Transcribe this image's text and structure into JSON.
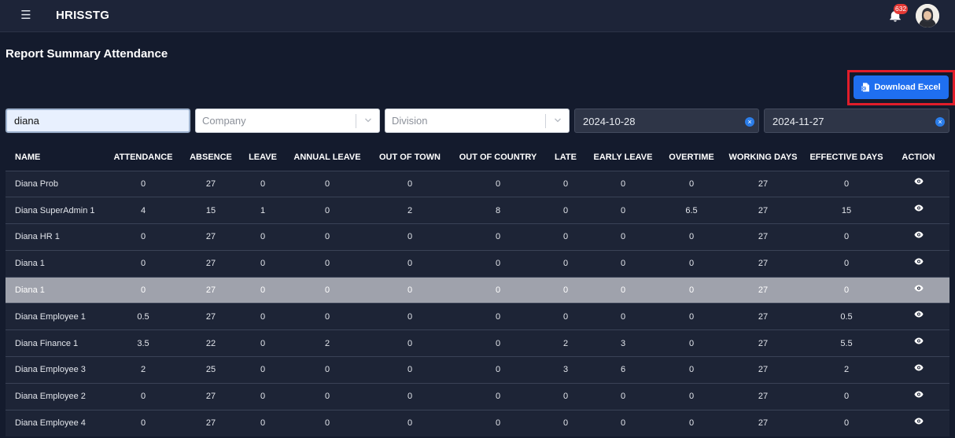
{
  "header": {
    "menu_icon": "hamburger-icon",
    "app_title": "HRISSTG",
    "notification_count": "632",
    "bell_icon": "bell-icon",
    "avatar_icon": "user-avatar"
  },
  "page": {
    "title": "Report Summary Attendance"
  },
  "toolbar": {
    "download_label": "Download Excel",
    "download_icon": "excel-file-icon",
    "highlight_color": "#e11d2a",
    "button_color": "#1f6ff0"
  },
  "filters": {
    "search_value": "diana",
    "company_placeholder": "Company",
    "division_placeholder": "Division",
    "start_date": "2024-10-28",
    "end_date": "2024-11-27"
  },
  "table": {
    "columns": [
      "NAME",
      "ATTENDANCE",
      "ABSENCE",
      "LEAVE",
      "ANNUAL LEAVE",
      "OUT OF TOWN",
      "OUT OF COUNTRY",
      "LATE",
      "EARLY LEAVE",
      "OVERTIME",
      "WORKING DAYS",
      "EFFECTIVE DAYS",
      "ACTION"
    ],
    "rows": [
      {
        "name": "Diana Prob",
        "attendance": "0",
        "absence": "27",
        "leave": "0",
        "annual_leave": "0",
        "out_of_town": "0",
        "out_of_country": "0",
        "late": "0",
        "early_leave": "0",
        "overtime": "0",
        "working_days": "27",
        "effective_days": "0"
      },
      {
        "name": "Diana SuperAdmin 1",
        "attendance": "4",
        "absence": "15",
        "leave": "1",
        "annual_leave": "0",
        "out_of_town": "2",
        "out_of_country": "8",
        "late": "0",
        "early_leave": "0",
        "overtime": "6.5",
        "working_days": "27",
        "effective_days": "15"
      },
      {
        "name": "Diana HR 1",
        "attendance": "0",
        "absence": "27",
        "leave": "0",
        "annual_leave": "0",
        "out_of_town": "0",
        "out_of_country": "0",
        "late": "0",
        "early_leave": "0",
        "overtime": "0",
        "working_days": "27",
        "effective_days": "0"
      },
      {
        "name": "Diana 1",
        "attendance": "0",
        "absence": "27",
        "leave": "0",
        "annual_leave": "0",
        "out_of_town": "0",
        "out_of_country": "0",
        "late": "0",
        "early_leave": "0",
        "overtime": "0",
        "working_days": "27",
        "effective_days": "0"
      },
      {
        "name": "Diana 1",
        "attendance": "0",
        "absence": "27",
        "leave": "0",
        "annual_leave": "0",
        "out_of_town": "0",
        "out_of_country": "0",
        "late": "0",
        "early_leave": "0",
        "overtime": "0",
        "working_days": "27",
        "effective_days": "0",
        "selected": true
      },
      {
        "name": "Diana Employee 1",
        "attendance": "0.5",
        "absence": "27",
        "leave": "0",
        "annual_leave": "0",
        "out_of_town": "0",
        "out_of_country": "0",
        "late": "0",
        "early_leave": "0",
        "overtime": "0",
        "working_days": "27",
        "effective_days": "0.5"
      },
      {
        "name": "Diana Finance 1",
        "attendance": "3.5",
        "absence": "22",
        "leave": "0",
        "annual_leave": "2",
        "out_of_town": "0",
        "out_of_country": "0",
        "late": "2",
        "early_leave": "3",
        "overtime": "0",
        "working_days": "27",
        "effective_days": "5.5"
      },
      {
        "name": "Diana Employee 3",
        "attendance": "2",
        "absence": "25",
        "leave": "0",
        "annual_leave": "0",
        "out_of_town": "0",
        "out_of_country": "0",
        "late": "3",
        "early_leave": "6",
        "overtime": "0",
        "working_days": "27",
        "effective_days": "2"
      },
      {
        "name": "Diana Employee 2",
        "attendance": "0",
        "absence": "27",
        "leave": "0",
        "annual_leave": "0",
        "out_of_town": "0",
        "out_of_country": "0",
        "late": "0",
        "early_leave": "0",
        "overtime": "0",
        "working_days": "27",
        "effective_days": "0"
      },
      {
        "name": "Diana Employee 4",
        "attendance": "0",
        "absence": "27",
        "leave": "0",
        "annual_leave": "0",
        "out_of_town": "0",
        "out_of_country": "0",
        "late": "0",
        "early_leave": "0",
        "overtime": "0",
        "working_days": "27",
        "effective_days": "0"
      }
    ],
    "action_icon": "eye-icon"
  }
}
